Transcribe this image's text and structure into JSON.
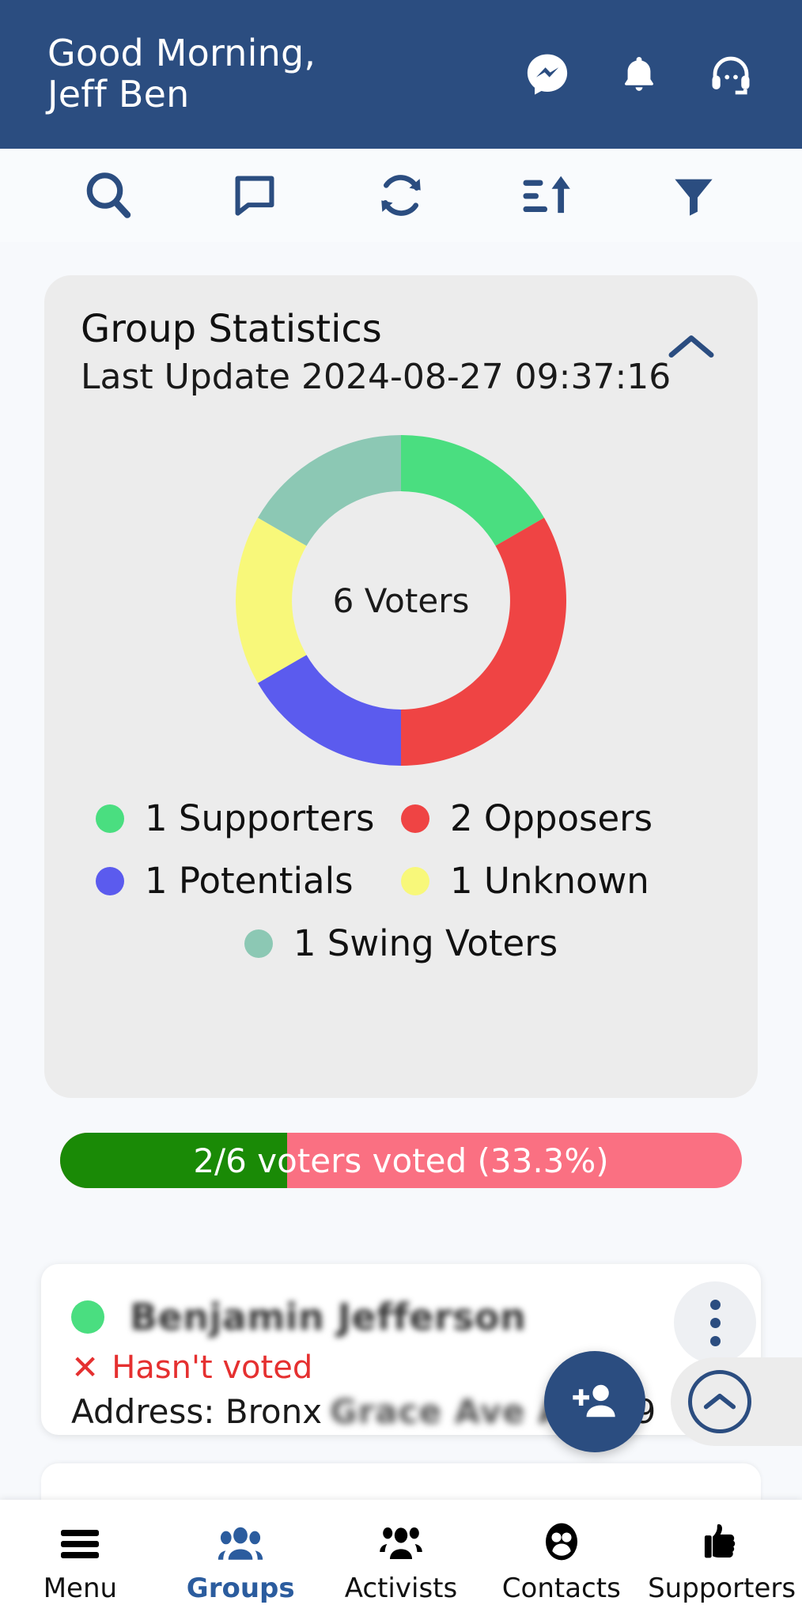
{
  "header": {
    "greeting_line1": "Good Morning,",
    "greeting_line2": "Jeff Ben",
    "icons": [
      "messenger-icon",
      "bell-icon",
      "support-headset-icon"
    ],
    "background": "#2b4d80"
  },
  "toolbar": {
    "items": [
      {
        "name": "search-icon"
      },
      {
        "name": "comment-icon"
      },
      {
        "name": "refresh-icon"
      },
      {
        "name": "sort-ascending-icon"
      },
      {
        "name": "filter-icon"
      }
    ],
    "color": "#2b4d80"
  },
  "stats": {
    "title": "Group Statistics",
    "last_update": "Last Update 2024-08-27 09:37:16",
    "collapse_icon": "chevron-up-icon",
    "center_label": "6 Voters",
    "legend": [
      {
        "label": "1 Supporters",
        "color": "#4ade80"
      },
      {
        "label": "2 Opposers",
        "color": "#ef4444"
      },
      {
        "label": "1 Potentials",
        "color": "#5b5bee"
      },
      {
        "label": "1 Unknown",
        "color": "#f8f87a"
      },
      {
        "label": "1 Swing Voters",
        "color": "#8cc8b4"
      }
    ]
  },
  "chart_data": {
    "type": "pie",
    "title": "Group Statistics",
    "subtitle": "Last Update 2024-08-27 09:37:16",
    "center_label": "6 Voters",
    "total": 6,
    "categories": [
      "Supporters",
      "Opposers",
      "Potentials",
      "Unknown",
      "Swing Voters"
    ],
    "values": [
      1,
      2,
      1,
      1,
      1
    ],
    "colors": [
      "#4ade80",
      "#ef4444",
      "#5b5bee",
      "#f8f87a",
      "#8cc8b4"
    ],
    "legend_position": "bottom",
    "donut": true,
    "inner_radius_ratio": 0.66,
    "start_angle_deg": 0
  },
  "progress": {
    "text": "2/6 voters voted (33.3%)",
    "percent": 33.3,
    "fill_color": "#1a8a06",
    "track_color": "#fa7082"
  },
  "voter_card": {
    "status_dot_color": "#4ade80",
    "name": "Benjamin Jefferson",
    "vote_status": "Hasn't voted",
    "vote_status_icon": "x-icon",
    "address_prefix": "Address: Bronx",
    "address_redacted": "Grace Ave Apt",
    "address_suffix": "29",
    "menu_icon": "kebab-menu-icon"
  },
  "fab": {
    "add_person_icon": "add-person-icon",
    "scroll_top_icon": "chevron-up-circle-icon"
  },
  "bottom_nav": {
    "items": [
      {
        "label": "Menu",
        "icon": "hamburger-icon",
        "active": false
      },
      {
        "label": "Groups",
        "icon": "group-people-icon",
        "active": true
      },
      {
        "label": "Activists",
        "icon": "activists-people-icon",
        "active": false
      },
      {
        "label": "Contacts",
        "icon": "contacts-circle-icon",
        "active": false
      },
      {
        "label": "Supporters",
        "icon": "thumbs-up-icon",
        "active": false
      }
    ],
    "active_color": "#2b5c9e"
  }
}
